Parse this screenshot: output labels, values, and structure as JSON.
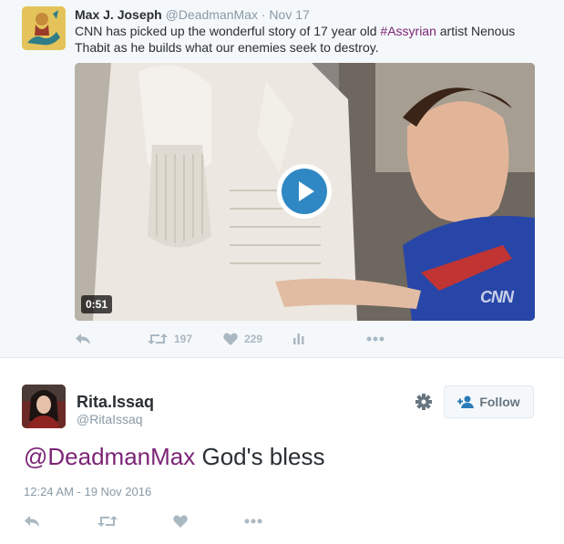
{
  "parent_tweet": {
    "name": "Max J. Joseph",
    "handle": "@DeadmanMax",
    "separator": "·",
    "time": "Nov 17",
    "text_before": "CNN has picked up the wonderful story of 17 year old ",
    "hashtag": "#Assyrian",
    "text_after": " artist Nenous Thabit as he builds what our enemies seek to destroy.",
    "video": {
      "duration": "0:51",
      "watermark": "CNN"
    },
    "actions": {
      "retweet_count": "197",
      "like_count": "229"
    }
  },
  "focused_tweet": {
    "name": "Rita.Issaq",
    "handle": "@RitaIssaq",
    "follow_label": "Follow",
    "mention": "@DeadmanMax",
    "text": " God's bless",
    "timestamp": "12:24 AM - 19 Nov 2016"
  },
  "colors": {
    "link": "#7b2476",
    "muted": "#8899a6",
    "action_icons": "#aab8c2",
    "play_button": "#2f88c4"
  },
  "icons": [
    "reply-icon",
    "retweet-icon",
    "like-icon",
    "analytics-icon",
    "more-icon",
    "play-icon",
    "gear-icon",
    "follow-person-icon"
  ]
}
